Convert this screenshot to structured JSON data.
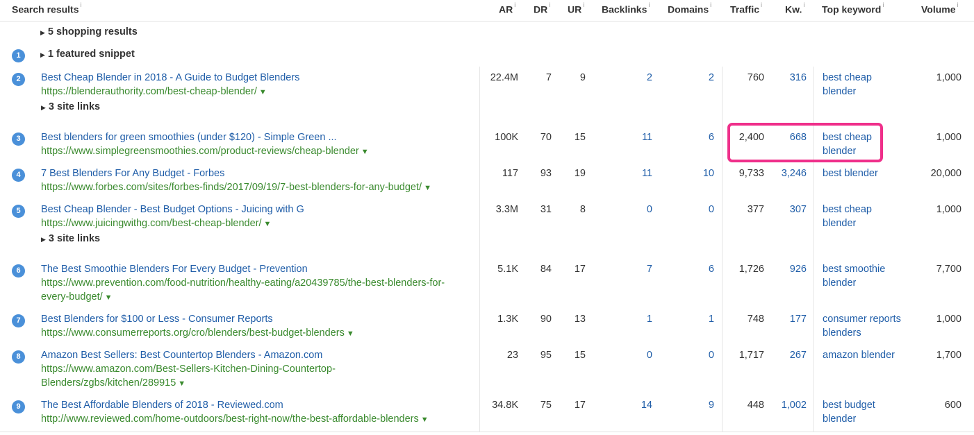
{
  "headers": {
    "search_results": "Search results",
    "ar": "AR",
    "dr": "DR",
    "ur": "UR",
    "backlinks": "Backlinks",
    "domains": "Domains",
    "traffic": "Traffic",
    "kw": "Kw.",
    "top_keyword": "Top keyword",
    "volume": "Volume",
    "info_mark": "i"
  },
  "shopping": "5 shopping results",
  "featured": "1 featured snippet",
  "featured_badge": "1",
  "sitelinks_label": "3 site links",
  "icons": {
    "expand": "triangle-right",
    "url_menu": "caret-down"
  },
  "colors": {
    "title": "#1f5da8",
    "url": "#3a8a2e",
    "badge": "#4a90d9",
    "highlight": "#ef2f8a"
  },
  "rows": [
    {
      "pos": "2",
      "title": "Best Cheap Blender in 2018 - A Guide to Budget Blenders",
      "url": [
        "https://blenderauthority.com/best-cheap-blender/"
      ],
      "sitelinks": true,
      "ar": "22.4M",
      "dr": "7",
      "ur": "9",
      "backlinks": "2",
      "domains": "2",
      "traffic": "760",
      "kw": "316",
      "top_keyword": [
        "best cheap",
        "blender"
      ],
      "volume": "1,000"
    },
    {
      "pos": "3",
      "title": "Best blenders for green smoothies (under $120) - Simple Green ...",
      "url": [
        "https://www.simplegreensmoothies.com/product-reviews/cheap-blender"
      ],
      "sitelinks": false,
      "ar": "100K",
      "dr": "70",
      "ur": "15",
      "backlinks": "11",
      "domains": "6",
      "traffic": "2,400",
      "kw": "668",
      "top_keyword": [
        "best cheap",
        "blender"
      ],
      "volume": "1,000"
    },
    {
      "pos": "4",
      "title": "7 Best Blenders For Any Budget - Forbes",
      "url": [
        "https://www.forbes.com/sites/forbes-finds/2017/09/19/7-best-blenders-for-any-budget/"
      ],
      "sitelinks": false,
      "ar": "117",
      "dr": "93",
      "ur": "19",
      "backlinks": "11",
      "domains": "10",
      "traffic": "9,733",
      "kw": "3,246",
      "top_keyword": [
        "best blender"
      ],
      "volume": "20,000"
    },
    {
      "pos": "5",
      "title": "Best Cheap Blender - Best Budget Options - Juicing with G",
      "url": [
        "https://www.juicingwithg.com/best-cheap-blender/"
      ],
      "sitelinks": true,
      "ar": "3.3M",
      "dr": "31",
      "ur": "8",
      "backlinks": "0",
      "domains": "0",
      "traffic": "377",
      "kw": "307",
      "top_keyword": [
        "best cheap",
        "blender"
      ],
      "volume": "1,000"
    },
    {
      "pos": "6",
      "title": "The Best Smoothie Blenders For Every Budget - Prevention",
      "url": [
        "https://www.prevention.com/food-nutrition/healthy-eating/a20439785/the-best-blenders-for-",
        "every-budget/"
      ],
      "sitelinks": false,
      "ar": "5.1K",
      "dr": "84",
      "ur": "17",
      "backlinks": "7",
      "domains": "6",
      "traffic": "1,726",
      "kw": "926",
      "top_keyword": [
        "best smoothie",
        "blender"
      ],
      "volume": "7,700"
    },
    {
      "pos": "7",
      "title": "Best Blenders for $100 or Less - Consumer Reports",
      "url": [
        "https://www.consumerreports.org/cro/blenders/best-budget-blenders"
      ],
      "sitelinks": false,
      "ar": "1.3K",
      "dr": "90",
      "ur": "13",
      "backlinks": "1",
      "domains": "1",
      "traffic": "748",
      "kw": "177",
      "top_keyword": [
        "consumer reports",
        "blenders"
      ],
      "volume": "1,000"
    },
    {
      "pos": "8",
      "title": "Amazon Best Sellers: Best Countertop Blenders - Amazon.com",
      "url": [
        "https://www.amazon.com/Best-Sellers-Kitchen-Dining-Countertop-",
        "Blenders/zgbs/kitchen/289915"
      ],
      "sitelinks": false,
      "ar": "23",
      "dr": "95",
      "ur": "15",
      "backlinks": "0",
      "domains": "0",
      "traffic": "1,717",
      "kw": "267",
      "top_keyword": [
        "amazon blender"
      ],
      "volume": "1,700"
    },
    {
      "pos": "9",
      "title": "The Best Affordable Blenders of 2018 - Reviewed.com",
      "url": [
        "http://www.reviewed.com/home-outdoors/best-right-now/the-best-affordable-blenders"
      ],
      "sitelinks": false,
      "ar": "34.8K",
      "dr": "75",
      "ur": "17",
      "backlinks": "14",
      "domains": "9",
      "traffic": "448",
      "kw": "1,002",
      "top_keyword": [
        "best budget",
        "blender"
      ],
      "volume": "600"
    }
  ]
}
